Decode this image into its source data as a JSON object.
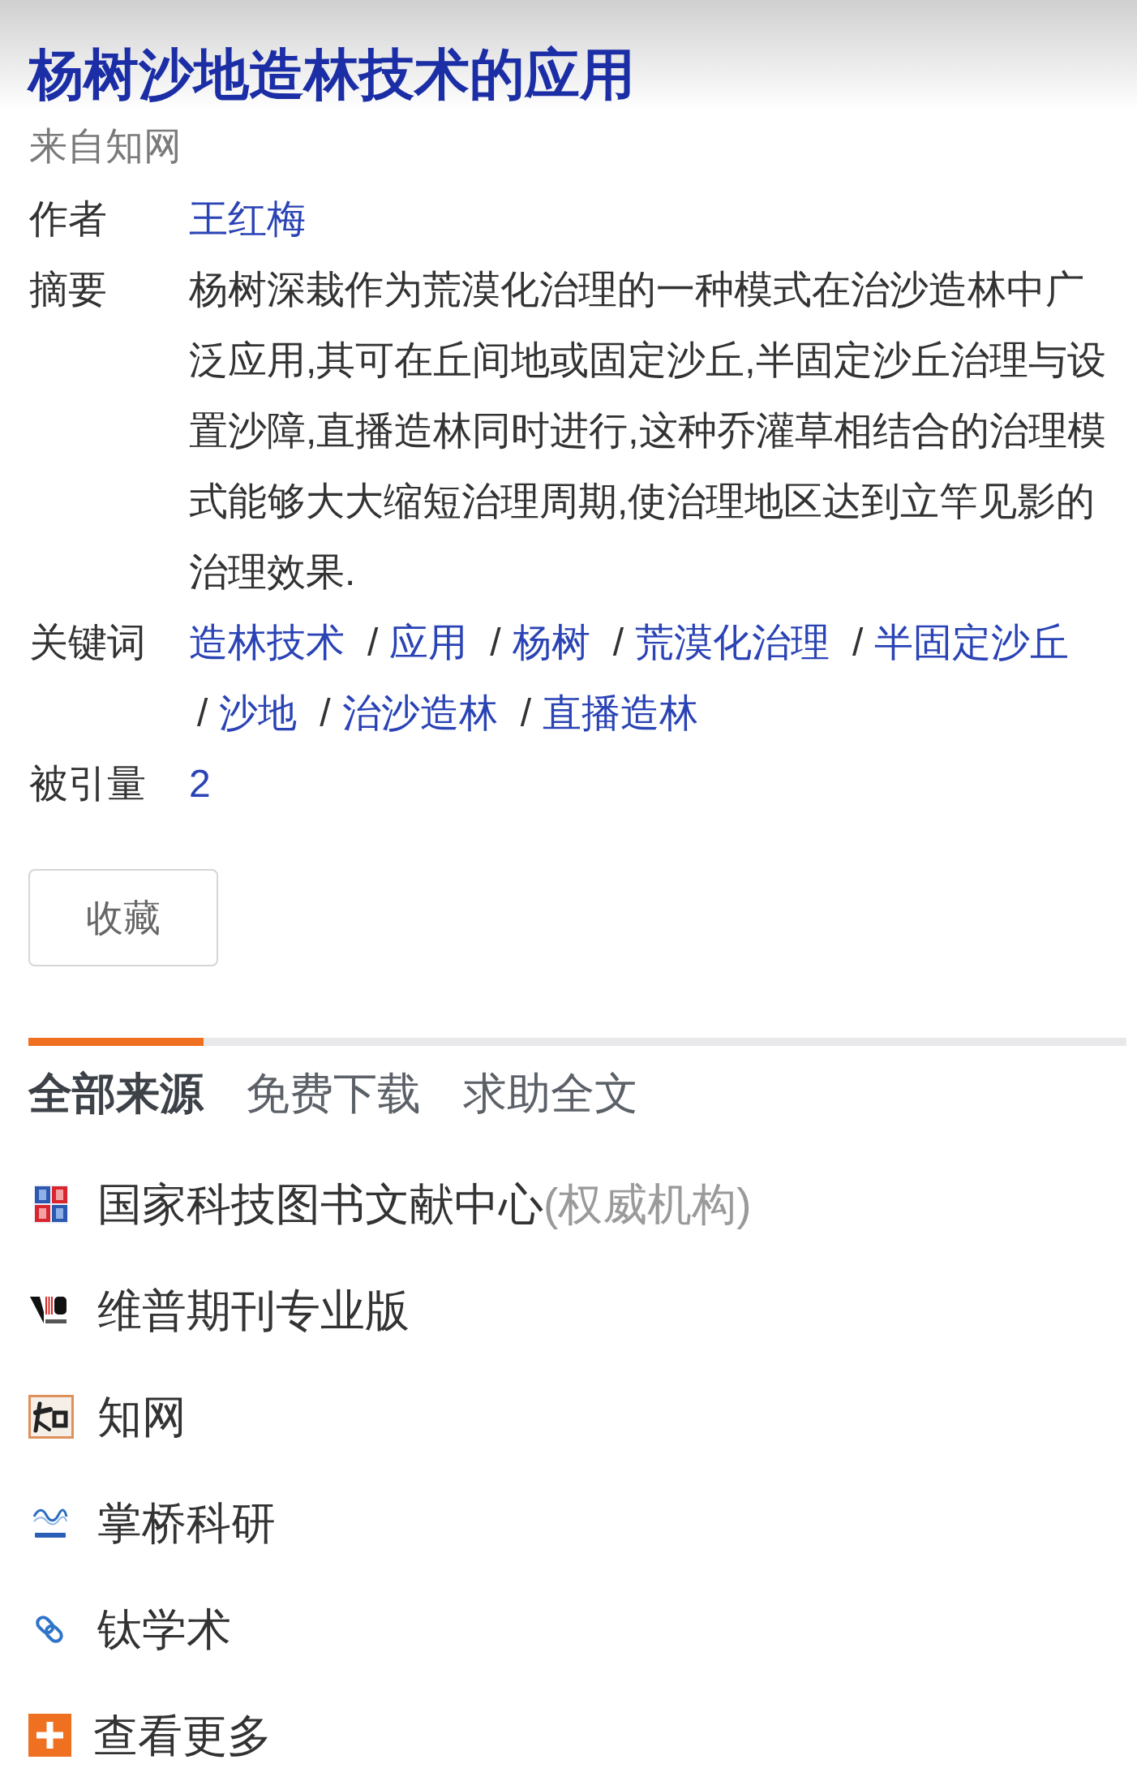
{
  "title": "杨树沙地造林技术的应用",
  "source_note": "来自知网",
  "fields": [
    {
      "kind": "author",
      "label": "作者",
      "value": "王红梅"
    },
    {
      "kind": "abstract",
      "label": "摘要",
      "value": "杨树深栽作为荒漠化治理的一种模式在治沙造林中广泛应用,其可在丘间地或固定沙丘,半固定沙丘治理与设置沙障,直播造林同时进行,这种乔灌草相结合的治理模式能够大大缩短治理周期,使治理地区达到立竿见影的治理效果."
    },
    {
      "kind": "keywords",
      "label": "关键词",
      "keywords": [
        {
          "text": "造林技术"
        },
        {
          "separator": "/",
          "text": "应用"
        },
        {
          "separator": "/",
          "text": "杨树"
        },
        {
          "separator": "/",
          "text": "荒漠化治理"
        },
        {
          "separator": "/",
          "text": "半固定沙丘"
        },
        {
          "separator": "/",
          "text": "沙地"
        },
        {
          "separator": "/",
          "text": "治沙造林"
        },
        {
          "separator": "/",
          "text": "直播造林"
        }
      ]
    },
    {
      "kind": "citations",
      "label": "被引量",
      "value": "2"
    }
  ],
  "favorite_button": "收藏",
  "tabs": [
    {
      "label": "全部来源",
      "selected": true
    },
    {
      "label": "免费下载",
      "selected": false
    },
    {
      "label": "求助全文",
      "selected": false
    }
  ],
  "sources": [
    {
      "kind": "nstl",
      "name": "国家科技图书文献中心",
      "note": "(权威机构)"
    },
    {
      "kind": "vip",
      "name": "维普期刊专业版"
    },
    {
      "kind": "cnki",
      "name": "知网"
    },
    {
      "kind": "zhangqiao",
      "name": "掌桥科研"
    },
    {
      "kind": "chain",
      "name": "钛学术"
    },
    {
      "kind": "more",
      "name": "查看更多"
    }
  ]
}
